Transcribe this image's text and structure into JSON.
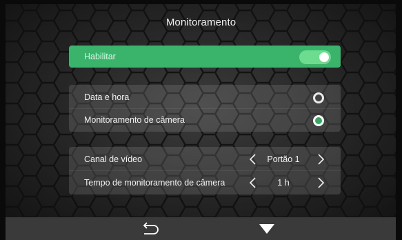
{
  "header": {
    "title": "Monitoramento"
  },
  "enable": {
    "label": "Habilitar",
    "state": "on"
  },
  "display_options": [
    {
      "label": "Data e hora",
      "selected": false
    },
    {
      "label": "Monitoramento de câmera",
      "selected": true
    }
  ],
  "video_channel": {
    "label": "Canal de vídeo",
    "value": "Portão 1"
  },
  "monitor_time": {
    "label": "Tempo de monitoramento de câmera",
    "value": "1 h"
  },
  "bottom_nav": {
    "back_icon": "return-icon",
    "down_icon": "arrow-down-icon"
  },
  "colors": {
    "accent": "#3bb46b",
    "toggle": "#6ddc8f",
    "panel": "#4a4a4a",
    "bottom_bar": "#3a3a3a"
  }
}
